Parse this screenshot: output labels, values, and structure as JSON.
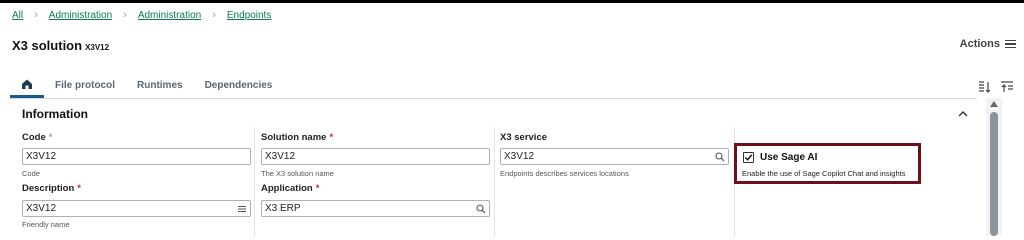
{
  "breadcrumb": [
    "All",
    "Administration",
    "Administration",
    "Endpoints"
  ],
  "page": {
    "title": "X3 solution",
    "subtitle": "X3V12",
    "actions_label": "Actions"
  },
  "tabs": [
    "File protocol",
    "Runtimes",
    "Dependencies"
  ],
  "section": {
    "title": "Information"
  },
  "fields": {
    "code": {
      "label": "Code",
      "required_mark": "*",
      "value": "X3V12",
      "help": "Code"
    },
    "solution_name": {
      "label": "Solution name",
      "required_mark": "*",
      "value": "X3V12",
      "help": "The X3 solution name"
    },
    "x3_service": {
      "label": "X3 service",
      "value": "X3V12",
      "help": "Endpoints describes services locations"
    },
    "description": {
      "label": "Description",
      "required_mark": "*",
      "value": "X3V12",
      "help": "Friendly name"
    },
    "application": {
      "label": "Application",
      "required_mark": "*",
      "value": "X3 ERP"
    }
  },
  "sage_ai": {
    "label": "Use Sage AI",
    "checked": true,
    "help": "Enable the use of Sage Copilot Chat and insights",
    "highlight_color": "#6e0f1c"
  },
  "colors": {
    "link": "#0b7a55",
    "required": "#c1272d",
    "tab_active": "#1a5a8a"
  },
  "icons": [
    "home-icon",
    "search-icon",
    "list-icon",
    "hamburger-icon",
    "sort-icon",
    "collapse-all-icon",
    "chevron-up-icon",
    "checkmark-icon"
  ]
}
